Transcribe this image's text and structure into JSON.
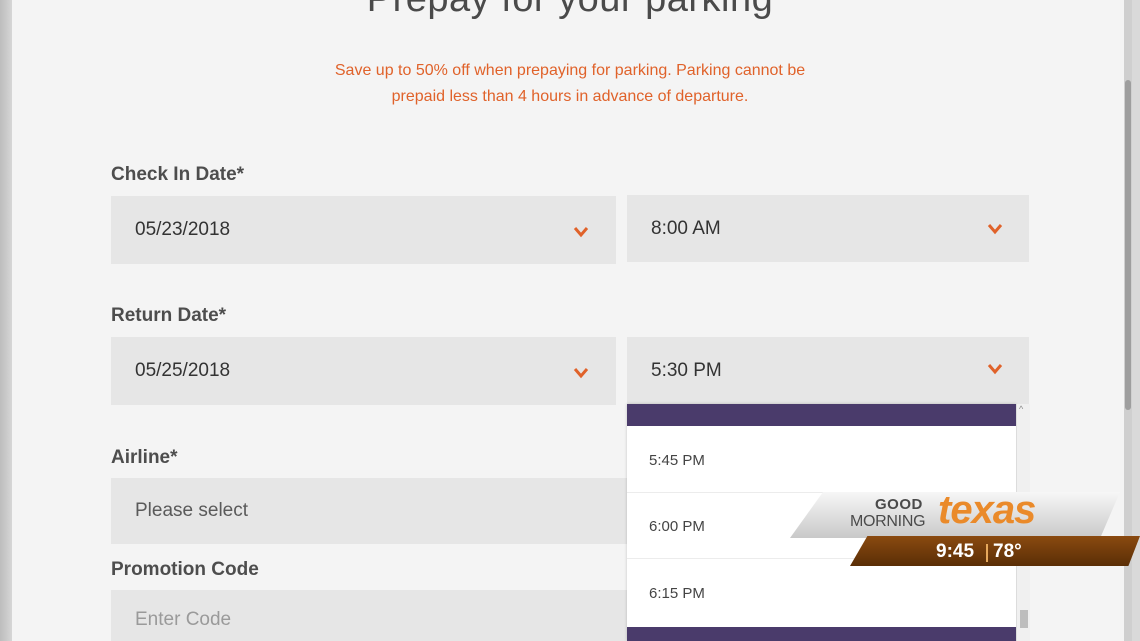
{
  "page": {
    "title": "Prepay for your parking",
    "notice_line1": "Save up to 50% off when prepaying for parking. Parking cannot be",
    "notice_line2": "prepaid less than 4 hours in advance of departure."
  },
  "check_in": {
    "label": "Check In Date*",
    "date": "05/23/2018",
    "time": "8:00 AM"
  },
  "return": {
    "label": "Return Date*",
    "date": "05/25/2018",
    "time": "5:30 PM"
  },
  "airline": {
    "label": "Airline*",
    "placeholder": "Please select"
  },
  "promotion": {
    "label": "Promotion Code",
    "placeholder": "Enter Code"
  },
  "time_dropdown": {
    "options": [
      "5:45 PM",
      "6:00 PM",
      "6:15 PM"
    ]
  },
  "tv_bug": {
    "good": "GOOD",
    "morning": "MORNING",
    "brand": "texas",
    "time": "9:45",
    "temp": "78°"
  },
  "colors": {
    "accent": "#e0622a",
    "dropdown_bar": "#4a3b6b",
    "field_bg": "#e6e6e6"
  },
  "icons": {
    "select_chevron": "chevron-down-icon"
  }
}
